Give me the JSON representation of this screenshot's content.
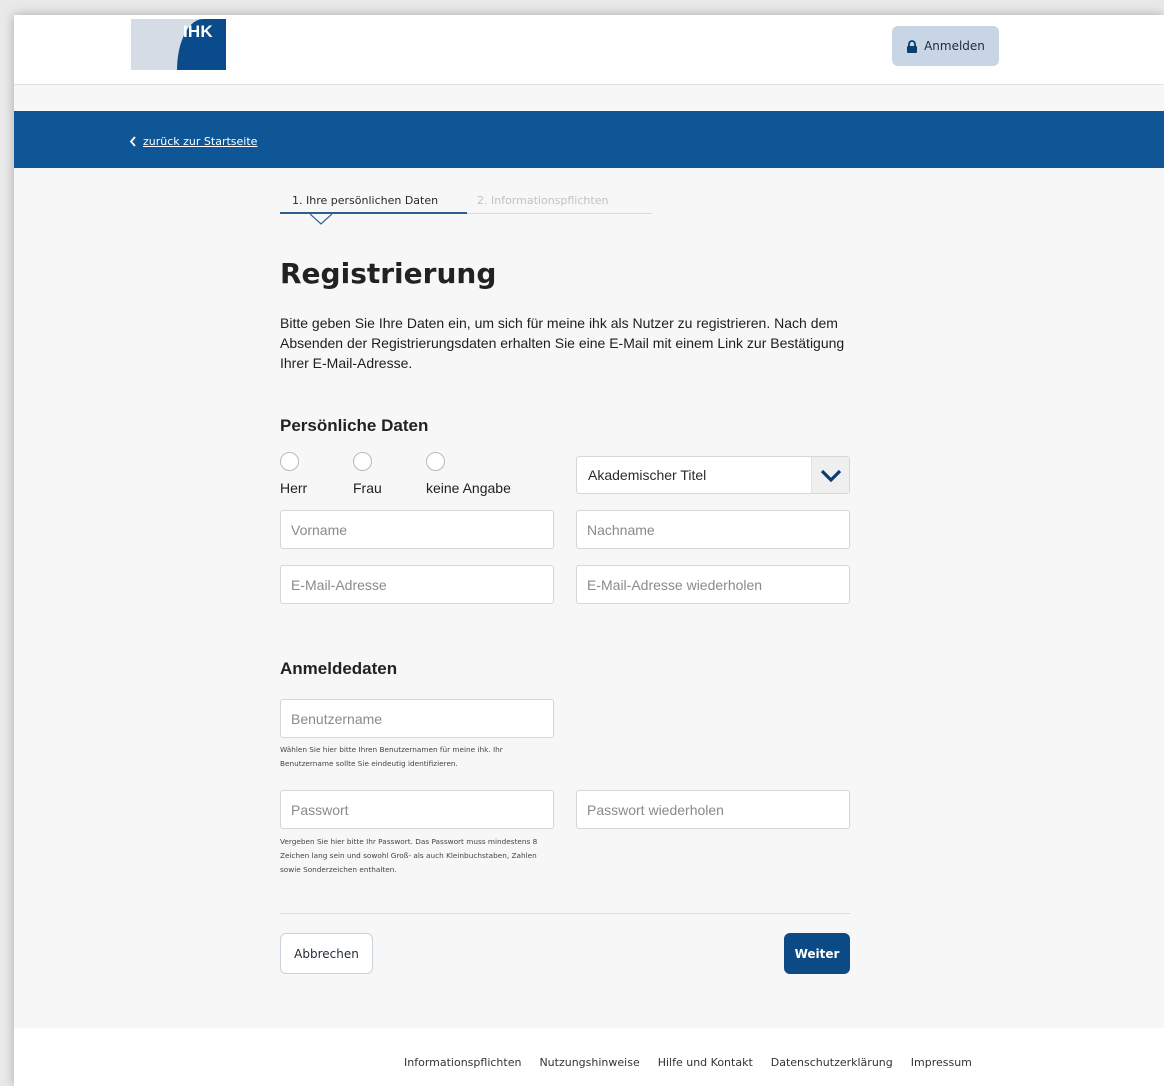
{
  "header": {
    "logo_text": "IHK",
    "login_label": "Anmelden",
    "colors": {
      "brand": "#0f5697",
      "brand_dark": "#0a4c8b",
      "login_bg": "#c7d5e4"
    }
  },
  "banner": {
    "back_label": "zurück zur Startseite"
  },
  "steps": [
    {
      "label": "1. Ihre persönlichen Daten",
      "active": true
    },
    {
      "label": "2. Informationspflichten",
      "active": false
    }
  ],
  "page": {
    "title": "Registrierung",
    "intro": "Bitte geben Sie Ihre Daten ein, um sich für meine ihk als Nutzer zu registrieren. Nach dem Absenden der Registrierungsdaten erhalten Sie eine E-Mail mit einem Link zur Bestätigung Ihrer E-Mail-Adresse."
  },
  "personal": {
    "title": "Persönliche Daten",
    "salutations": [
      {
        "label": "Herr",
        "selected": false
      },
      {
        "label": "Frau",
        "selected": false
      },
      {
        "label": "keine Angabe",
        "selected": false
      }
    ],
    "academic_title": {
      "value": "Akademischer Titel"
    },
    "firstname": {
      "placeholder": "Vorname",
      "value": ""
    },
    "lastname": {
      "placeholder": "Nachname",
      "value": ""
    },
    "email": {
      "placeholder": "E-Mail-Adresse",
      "value": ""
    },
    "email_repeat": {
      "placeholder": "E-Mail-Adresse wiederholen",
      "value": ""
    }
  },
  "login": {
    "title": "Anmeldedaten",
    "username": {
      "placeholder": "Benutzername",
      "value": "",
      "hint": "Wählen Sie hier bitte Ihren Benutzernamen für meine ihk. Ihr Benutzername sollte Sie eindeutig identifizieren."
    },
    "password": {
      "placeholder": "Passwort",
      "value": "",
      "hint": "Vergeben Sie hier bitte Ihr Passwort. Das Passwort muss mindestens 8 Zeichen lang sein und sowohl Groß- als auch Kleinbuchstaben, Zahlen sowie Sonderzeichen enthalten."
    },
    "password_repeat": {
      "placeholder": "Passwort wiederholen",
      "value": ""
    }
  },
  "actions": {
    "cancel_label": "Abbrechen",
    "next_label": "Weiter"
  },
  "footer": {
    "links": [
      "Informationspflichten",
      "Nutzungshinweise",
      "Hilfe und Kontakt",
      "Datenschutzerklärung",
      "Impressum"
    ]
  }
}
